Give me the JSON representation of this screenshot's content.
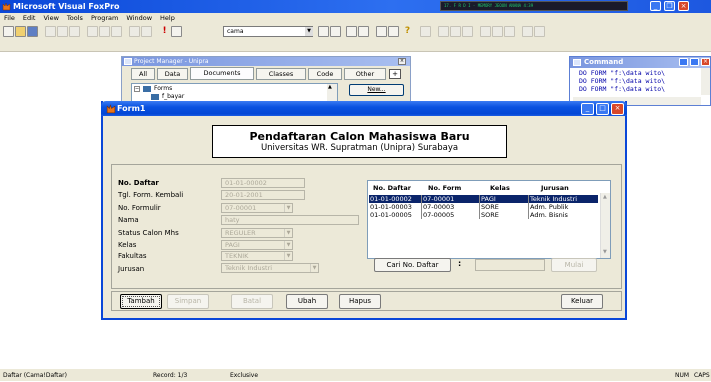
{
  "app": {
    "title": "Microsoft Visual FoxPro",
    "winamp_text": "17. F R D I - MEMORY JEOUN ANANA  4:39"
  },
  "menu": [
    "File",
    "Edit",
    "View",
    "Tools",
    "Program",
    "Window",
    "Help"
  ],
  "toolbar": {
    "combo_value": "cama"
  },
  "project_manager": {
    "title": "Project Manager - Unipra",
    "tabs": [
      "All",
      "Data",
      "Documents",
      "Classes",
      "Code",
      "Other"
    ],
    "active_tab": "Documents",
    "tree": [
      {
        "label": "Forms"
      },
      {
        "label": "f_bayar"
      }
    ],
    "new_button": "New..."
  },
  "command_window": {
    "title": "Command",
    "lines": [
      "DO FORM \"f:\\data wito\\",
      "DO FORM \"f:\\data wito\\",
      "DO FORM \"f:\\data wito\\"
    ]
  },
  "form1": {
    "title": "Form1",
    "header": {
      "title": "Pendaftaran Calon Mahasiswa Baru",
      "subtitle": "Universitas WR. Supratman (Unipra) Surabaya"
    },
    "fields": {
      "no_daftar": {
        "label": "No. Daftar",
        "value": "01-01-00002"
      },
      "tgl_form_kembali": {
        "label": "Tgl. Form. Kembali",
        "value": "20-01-2001"
      },
      "no_formulir": {
        "label": "No. Formulir",
        "value": "07-00001"
      },
      "nama": {
        "label": "Nama",
        "value": "haty"
      },
      "status_calon_mhs": {
        "label": "Status Calon Mhs",
        "value": "REGULER"
      },
      "kelas": {
        "label": "Kelas",
        "value": "PAGI"
      },
      "fakultas": {
        "label": "Fakultas",
        "value": "TEKNIK"
      },
      "jurusan": {
        "label": "Jurusan",
        "value": "Teknik Industri"
      }
    },
    "grid": {
      "columns": [
        "No. Daftar",
        "No. Form",
        "Kelas",
        "Jurusan"
      ],
      "rows": [
        {
          "no_daftar": "01-01-00002",
          "no_form": "07-00001",
          "kelas": "PAGI",
          "jurusan": "Teknik Industri",
          "selected": true
        },
        {
          "no_daftar": "01-01-00003",
          "no_form": "07-00003",
          "kelas": "SORE",
          "jurusan": "Adm. Publik",
          "selected": false
        },
        {
          "no_daftar": "01-01-00005",
          "no_form": "07-00005",
          "kelas": "SORE",
          "jurusan": "Adm. Bisnis",
          "selected": false
        }
      ]
    },
    "search": {
      "button": "Cari No. Daftar",
      "separator": ":",
      "input_value": "",
      "mulai_button": "Mulai"
    },
    "buttons": {
      "tambah": "Tambah",
      "simpan": "Simpan",
      "batal": "Batal",
      "ubah": "Ubah",
      "hapus": "Hapus",
      "keluar": "Keluar"
    }
  },
  "statusbar": {
    "table": "Daftar (Cama!Daftar)",
    "record": "Record: 1/3",
    "mode": "Exclusive",
    "num": "NUM",
    "caps": "CAPS"
  },
  "colors": {
    "xp_title_blue": "#0a47d8",
    "grid_selection": "#0a246a",
    "dialog_face": "#ece9d8"
  }
}
